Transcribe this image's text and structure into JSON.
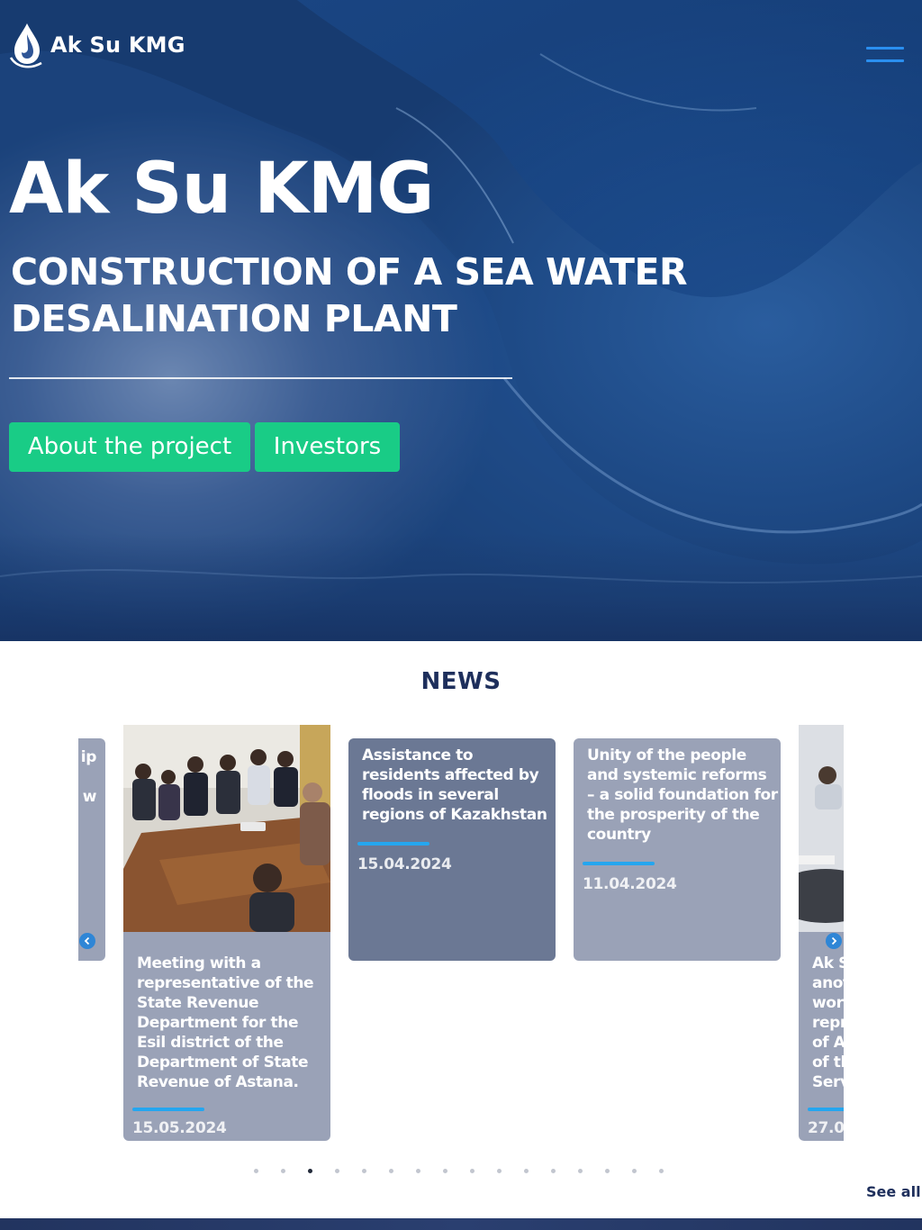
{
  "header": {
    "logo_text": "Ak Su KMG",
    "menu_icon": "hamburger-menu-icon"
  },
  "hero": {
    "title": "Ak Su KMG",
    "subtitle": "CONSTRUCTION OF A SEA WATER DESALINATION PLANT",
    "buttons": {
      "about": "About the project",
      "investors": "Investors"
    },
    "colors": {
      "button": "#19cc86",
      "menu": "#2a8ff0"
    }
  },
  "news": {
    "title": "NEWS",
    "cards": [
      {
        "title_fragment": "ip\n\nw"
      },
      {
        "title": "Meeting with a representative of the State Revenue Department for the Esil district of the Department of State Revenue of Astana.",
        "date": "15.05.2024"
      },
      {
        "title": "Assistance to residents affected by floods in several regions of Kazakhstan",
        "date": "15.04.2024"
      },
      {
        "title": "Unity of the people and systemic reforms – a solid foundation for the prosperity of the country",
        "date": "11.04.2024"
      },
      {
        "title_fragment": "Ak S\nanot\nwor\nrepr\nof A\nof th\nServ",
        "date_fragment": "27.0"
      }
    ],
    "pagination": {
      "total": 16,
      "active": 3
    },
    "see_all": "See all",
    "arrows": {
      "prev": "chevron-left-icon",
      "next": "chevron-right-icon"
    },
    "colors": {
      "accent": "#25a6ef",
      "card": "#9aa2b7",
      "card_highlight": "#6b7894",
      "title": "#1e2f5c"
    }
  }
}
